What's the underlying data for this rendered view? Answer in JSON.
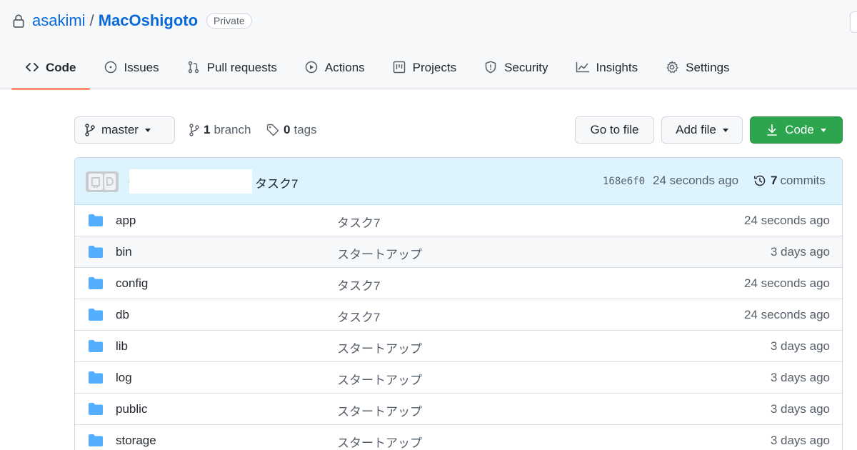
{
  "repo": {
    "owner": "asakimi",
    "separator": "/",
    "name": "MacOshigoto",
    "visibility": "Private"
  },
  "tabs": [
    {
      "label": "Code",
      "icon": "code-icon",
      "active": true
    },
    {
      "label": "Issues",
      "icon": "issue-icon"
    },
    {
      "label": "Pull requests",
      "icon": "pull-request-icon"
    },
    {
      "label": "Actions",
      "icon": "play-icon"
    },
    {
      "label": "Projects",
      "icon": "project-icon"
    },
    {
      "label": "Security",
      "icon": "shield-icon"
    },
    {
      "label": "Insights",
      "icon": "graph-icon"
    },
    {
      "label": "Settings",
      "icon": "gear-icon"
    }
  ],
  "toolbar": {
    "branch": "master",
    "branch_count": "1",
    "branch_label": "branch",
    "tag_count": "0",
    "tag_label": "tags",
    "goto_label": "Go to file",
    "addfile_label": "Add file",
    "code_label": "Code"
  },
  "commit": {
    "message": "タスク7",
    "sha": "168e6f0",
    "time": "24 seconds ago",
    "count": "7",
    "count_label": "commits"
  },
  "files": [
    {
      "name": "app",
      "message": "タスク7",
      "time": "24 seconds ago"
    },
    {
      "name": "bin",
      "message": "スタートアップ",
      "time": "3 days ago"
    },
    {
      "name": "config",
      "message": "タスク7",
      "time": "24 seconds ago"
    },
    {
      "name": "db",
      "message": "タスク7",
      "time": "24 seconds ago"
    },
    {
      "name": "lib",
      "message": "スタートアップ",
      "time": "3 days ago"
    },
    {
      "name": "log",
      "message": "スタートアップ",
      "time": "3 days ago"
    },
    {
      "name": "public",
      "message": "スタートアップ",
      "time": "3 days ago"
    },
    {
      "name": "storage",
      "message": "スタートアップ",
      "time": "3 days ago"
    }
  ],
  "colors": {
    "link": "#0969da",
    "primary_button": "#2da44e",
    "active_tab_underline": "#fd8c73",
    "folder": "#54aeff",
    "commit_bar": "#ddf4ff"
  }
}
